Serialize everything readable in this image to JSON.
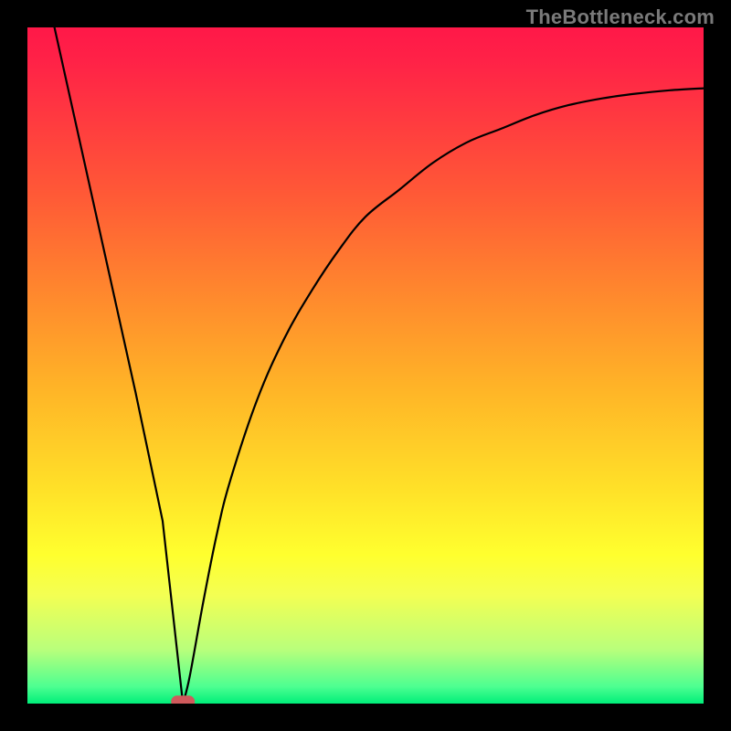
{
  "watermark": "TheBottleneck.com",
  "colors": {
    "background": "#000000",
    "curve": "#000000",
    "marker": "#cf5a5c",
    "gradient_top": "#ff1848",
    "gradient_bottom": "#00ee79"
  },
  "chart_data": {
    "type": "line",
    "title": "",
    "xlabel": "",
    "ylabel": "",
    "xlim": [
      0,
      100
    ],
    "ylim": [
      0,
      100
    ],
    "x": [
      4,
      8,
      12,
      16,
      20,
      22,
      23,
      24,
      26,
      28,
      30,
      34,
      38,
      42,
      46,
      50,
      55,
      60,
      65,
      70,
      75,
      80,
      85,
      90,
      95,
      100
    ],
    "values": [
      100,
      82,
      64,
      46,
      27,
      9,
      0,
      4,
      15,
      25,
      33,
      45,
      54,
      61,
      67,
      72,
      76,
      80,
      83,
      85,
      87,
      88.5,
      89.5,
      90.2,
      90.7,
      91
    ],
    "annotations": [
      {
        "type": "marker",
        "x": 23,
        "y": 0.3,
        "shape": "pill",
        "color": "#cf5a5c"
      }
    ]
  }
}
